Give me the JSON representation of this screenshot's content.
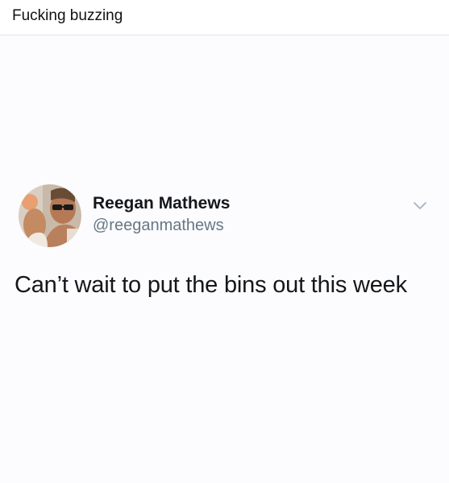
{
  "caption": {
    "text": "Fucking buzzing"
  },
  "tweet": {
    "author": {
      "display_name": "Reegan Mathews",
      "handle": "@reeganmathews"
    },
    "text": "Can’t wait to put the bins out this week",
    "menu_icon": "chevron-down-icon"
  },
  "colors": {
    "page_background": "#fcfbfd",
    "text_primary": "#14171a",
    "text_secondary": "#657786",
    "chevron": "#a9b4be"
  }
}
